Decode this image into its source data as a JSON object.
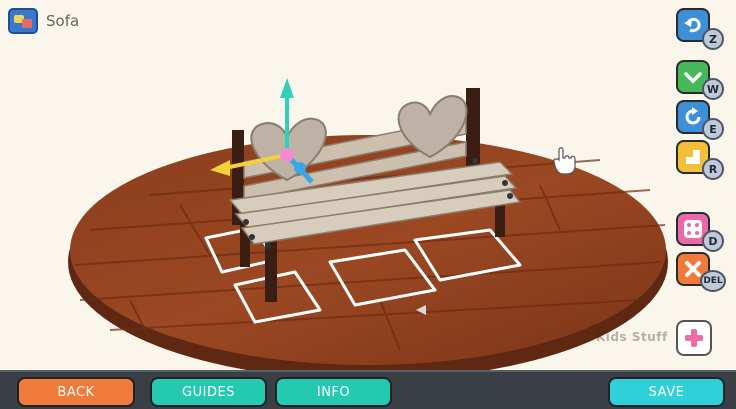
{
  "header": {
    "title": "Sofa",
    "app_icon": "picture-frame-icon"
  },
  "toolbar": {
    "undo": {
      "icon": "undo-arrow-icon",
      "key": "Z",
      "color": "#3f8fd8"
    },
    "move": {
      "icon": "chevron-down-icon",
      "key": "W",
      "color": "#46b85a"
    },
    "rotate": {
      "icon": "rotate-icon",
      "key": "E",
      "color": "#3f8fd8"
    },
    "resize": {
      "icon": "resize-icon",
      "key": "R",
      "color": "#f2bf3a"
    },
    "duplicate": {
      "icon": "dice-icon",
      "key": "D",
      "color": "#e86aa8"
    },
    "delete": {
      "icon": "close-icon",
      "key": "DEL",
      "color": "#f07a3a"
    },
    "add": {
      "icon": "plus-icon",
      "color": "#f06aa8"
    }
  },
  "watermark": "Kids Stuff",
  "bottom_bar": {
    "back": {
      "label": "BACK",
      "color": "#f07a3a"
    },
    "guides": {
      "label": "GUIDES",
      "color": "#25c9b0"
    },
    "info": {
      "label": "INFO",
      "color": "#25c9b0"
    },
    "save": {
      "label": "SAVE",
      "color": "#2fd0d8"
    }
  }
}
